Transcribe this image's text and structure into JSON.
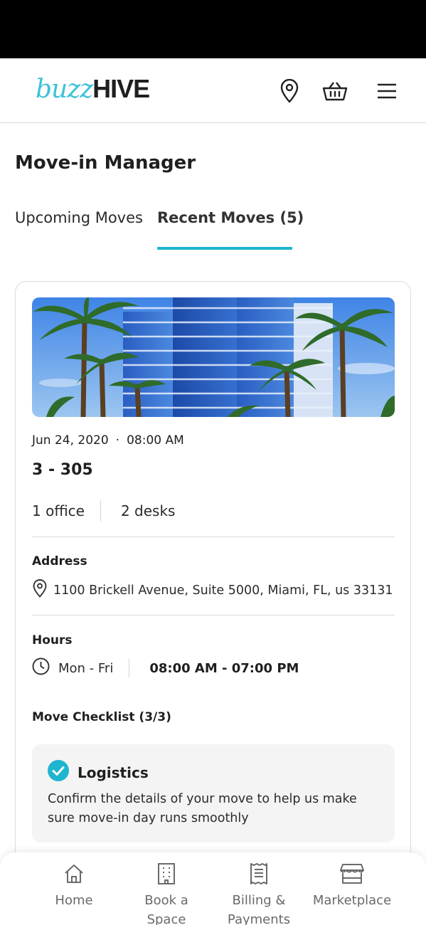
{
  "header": {
    "logo_buzz": "buzz",
    "logo_hive": "HIVE",
    "icons": [
      "location-pin-icon",
      "basket-icon",
      "hamburger-menu-icon"
    ],
    "brand_color": "#3cc3d6"
  },
  "page": {
    "title": "Move-in Manager"
  },
  "tabs": [
    {
      "label": "Upcoming Moves",
      "active": false
    },
    {
      "label": "Recent Moves (5)",
      "active": true
    }
  ],
  "accent_color": "#1fb5d0",
  "move": {
    "date": "Jun 24, 2020",
    "dot": "·",
    "time": "08:00 AM",
    "unit": "3 - 305",
    "offices": "1 office",
    "desks": "2 desks",
    "address_label": "Address",
    "address": "1100 Brickell Avenue, Suite 5000, Miami, FL, us 33131",
    "hours_label": "Hours",
    "days": "Mon - Fri",
    "hours": "08:00 AM - 07:00 PM",
    "checklist_label": "Move Checklist (3/3)",
    "checklist": [
      {
        "title": "Logistics",
        "description": "Confirm the details of your move to help us make sure move-in day runs smoothly",
        "done": true
      }
    ]
  },
  "bottom_nav": {
    "items": [
      {
        "label_line1": "Home",
        "label_line2": "",
        "icon": "home-icon"
      },
      {
        "label_line1": "Book a",
        "label_line2": "Space",
        "icon": "building-icon"
      },
      {
        "label_line1": "Billing &",
        "label_line2": "Payments",
        "icon": "receipt-icon"
      },
      {
        "label_line1": "Marketplace",
        "label_line2": "",
        "icon": "storefront-icon"
      }
    ]
  }
}
